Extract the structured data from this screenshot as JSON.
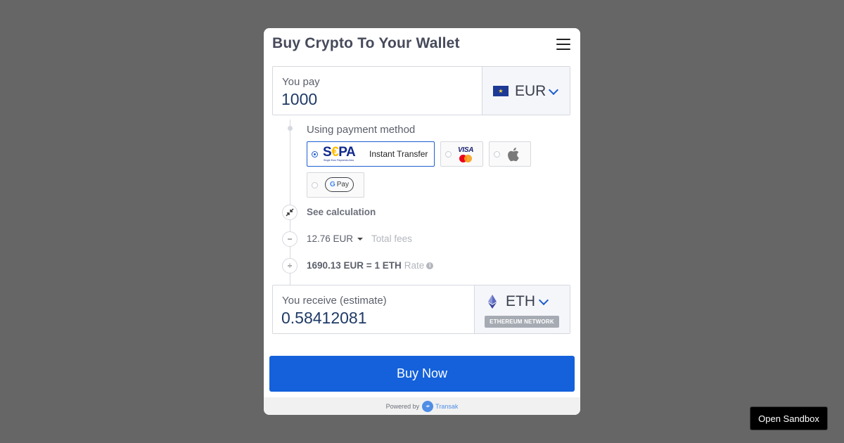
{
  "widget": {
    "title": "Buy Crypto To Your Wallet",
    "pay": {
      "label": "You pay",
      "amount": "1000",
      "currency": "EUR"
    },
    "payment_methods": {
      "label": "Using payment method",
      "options": [
        {
          "id": "sepa",
          "logo_text": "SEPA",
          "logo_subtext": "Single Euro Payments Area",
          "label": "Instant Transfer",
          "selected": true
        },
        {
          "id": "card",
          "logo_text": "VISA",
          "selected": false
        },
        {
          "id": "apple-pay",
          "selected": false
        },
        {
          "id": "google-pay",
          "logo_text": "Pay",
          "selected": false
        }
      ]
    },
    "calculation": {
      "toggle_label": "See calculation",
      "fee_value": "12.76 EUR",
      "fee_label": "Total fees",
      "rate_value": "1690.13 EUR = 1 ETH",
      "rate_label": "Rate"
    },
    "receive": {
      "label": "You receive (estimate)",
      "amount": "0.58412081",
      "currency": "ETH",
      "network": "ETHEREUM NETWORK"
    },
    "buy_button": "Buy Now",
    "footer": {
      "powered_by": "Powered by",
      "brand": "Transak"
    }
  },
  "sandbox_button": "Open Sandbox",
  "colors": {
    "page_background": "#666666",
    "accent": "#1461db",
    "text_primary": "#464a5a"
  },
  "icons": [
    "menu-icon",
    "eu-flag-icon",
    "chevron-down-icon",
    "ethereum-icon",
    "apple-icon",
    "collapse-icon",
    "minus-icon",
    "divide-icon",
    "info-icon",
    "transak-logo-icon"
  ]
}
